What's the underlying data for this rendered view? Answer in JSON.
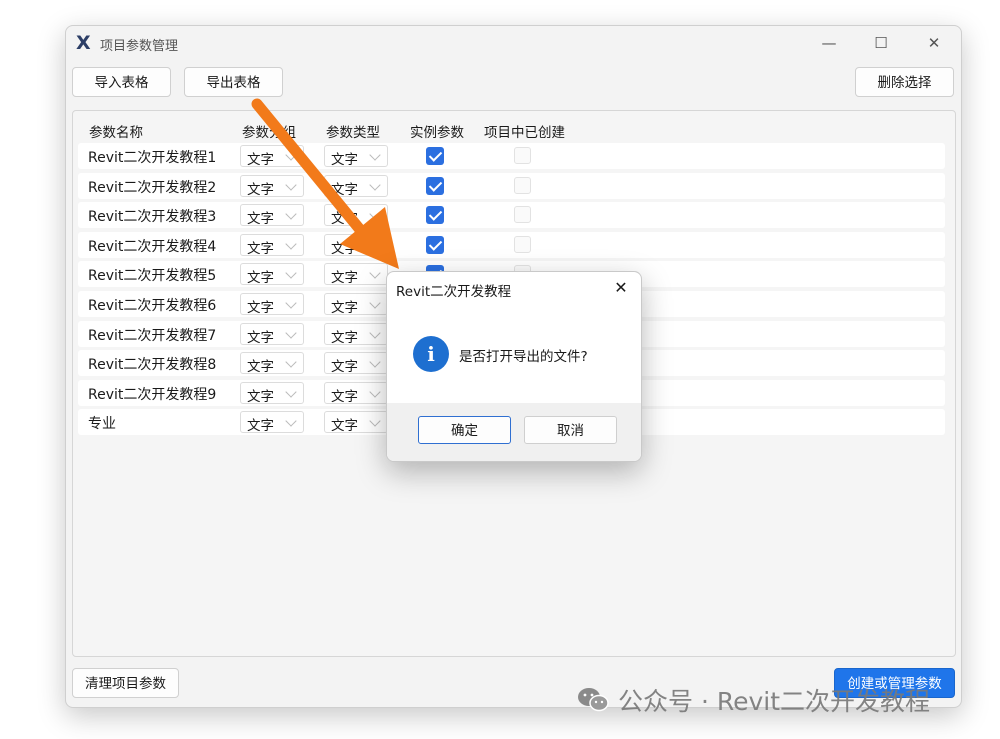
{
  "window": {
    "title": "项目参数管理",
    "logo": "X",
    "controls": {
      "minimize": "—",
      "maximize": "☐",
      "close": "✕"
    }
  },
  "toolbar": {
    "import_label": "导入表格",
    "export_label": "导出表格",
    "delete_label": "删除选择"
  },
  "table": {
    "headers": [
      "参数名称",
      "参数分组",
      "参数类型",
      "实例参数",
      "项目中已创建"
    ],
    "rows": [
      {
        "name": "Revit二次开发教程1",
        "group": "文字",
        "type": "文字",
        "instance": true,
        "created": false
      },
      {
        "name": "Revit二次开发教程2",
        "group": "文字",
        "type": "文字",
        "instance": true,
        "created": false
      },
      {
        "name": "Revit二次开发教程3",
        "group": "文字",
        "type": "文字",
        "instance": true,
        "created": false
      },
      {
        "name": "Revit二次开发教程4",
        "group": "文字",
        "type": "文字",
        "instance": true,
        "created": false
      },
      {
        "name": "Revit二次开发教程5",
        "group": "文字",
        "type": "文字",
        "instance": true,
        "created": false
      },
      {
        "name": "Revit二次开发教程6",
        "group": "文字",
        "type": "文字",
        "instance": true,
        "created": false
      },
      {
        "name": "Revit二次开发教程7",
        "group": "文字",
        "type": "文字",
        "instance": true,
        "created": false
      },
      {
        "name": "Revit二次开发教程8",
        "group": "文字",
        "type": "文字",
        "instance": true,
        "created": false
      },
      {
        "name": "Revit二次开发教程9",
        "group": "文字",
        "type": "文字",
        "instance": true,
        "created": false
      },
      {
        "name": "专业",
        "group": "文字",
        "type": "文字",
        "instance": true,
        "created": false
      }
    ]
  },
  "footer": {
    "clear_label": "清理项目参数",
    "create_label": "创建或管理参数"
  },
  "dialog": {
    "title": "Revit二次开发教程",
    "close": "✕",
    "icon": "i",
    "message": "是否打开导出的文件?",
    "ok_label": "确定",
    "cancel_label": "取消"
  },
  "watermark": {
    "text": "公众号 · Revit二次开发教程"
  },
  "colors": {
    "accent": "#1f75ea",
    "checkbox": "#2b6fe0",
    "annotation_arrow": "#f27a1a"
  },
  "icons": [
    "app-logo-icon",
    "minimize-icon",
    "maximize-icon",
    "close-icon",
    "info-icon",
    "wechat-icon",
    "annotation-arrow"
  ]
}
